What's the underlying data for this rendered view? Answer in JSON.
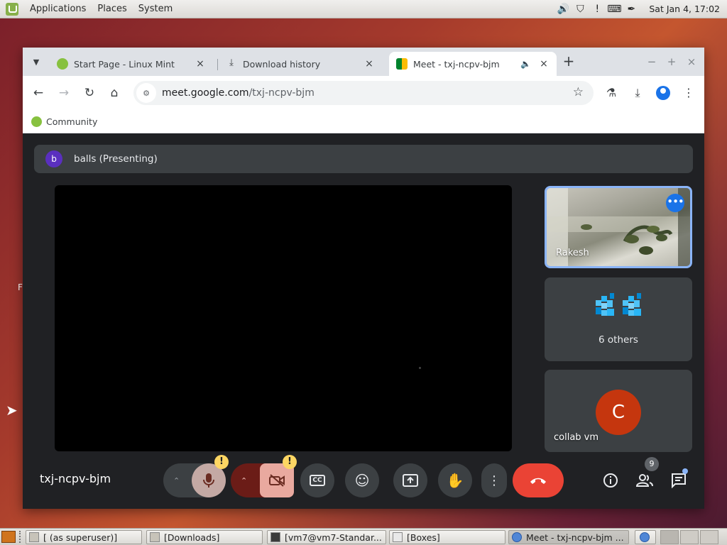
{
  "top_panel": {
    "menus": [
      "Applications",
      "Places",
      "System"
    ],
    "clock": "Sat Jan  4, 17:02"
  },
  "browser": {
    "tabs": [
      {
        "title": "Start Page - Linux Mint",
        "active": false
      },
      {
        "title": "Download history",
        "active": false
      },
      {
        "title": "Meet - txj-ncpv-bjm",
        "active": true
      }
    ],
    "url_host": "meet.google.com",
    "url_path": "/txj-ncpv-bjm",
    "bookmarks": [
      "Community"
    ]
  },
  "meet": {
    "presenter_initial": "b",
    "presenter_label": "balls (Presenting)",
    "participants": [
      {
        "name": "Rakesh",
        "type": "video"
      },
      {
        "name": "6 others",
        "type": "group"
      },
      {
        "name": "collab vm",
        "initial": "C",
        "avatar_color": "#c5360e"
      }
    ],
    "meeting_code": "txj-ncpv-bjm",
    "warning_badge": "!",
    "people_count": "9"
  },
  "desktop": {
    "side_letter": "F"
  },
  "taskbar": {
    "items": [
      {
        "label": "[ (as superuser)]",
        "active": false
      },
      {
        "label": "[Downloads]",
        "active": false
      },
      {
        "label": "[vm7@vm7-Standar...",
        "active": false
      },
      {
        "label": "[Boxes]",
        "active": false
      },
      {
        "label": "Meet - txj-ncpv-bjm ...",
        "active": true
      }
    ]
  },
  "colors": {
    "meet_bg": "#202124",
    "tile_bg": "#3c4043",
    "end_call": "#ea4335",
    "accent_blue": "#1a73e8",
    "selected_tile_border": "#8ab4f8"
  }
}
